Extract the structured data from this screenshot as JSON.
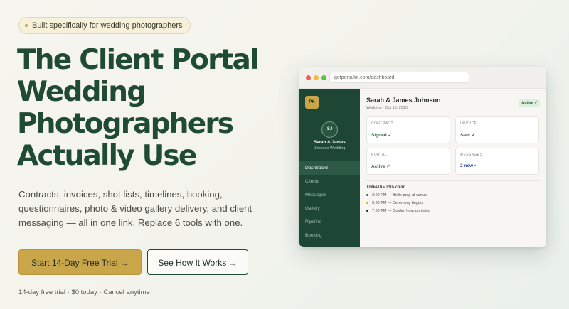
{
  "badge": {
    "text": "Built specifically for wedding photographers"
  },
  "hero": {
    "title_lines": [
      "The Client Portal",
      "Wedding",
      "Photographers",
      "Actually Use"
    ],
    "subtitle": "Contracts, invoices, shot lists, timelines, booking, questionnaires, photo & video gallery delivery, and client messaging — all in one link. Replace 6 tools with one.",
    "primary_cta": "Start 14-Day Free Trial →",
    "secondary_cta": "See How It Works →",
    "fine_print": "14-day free trial · $0 today · Cancel anytime"
  },
  "browser": {
    "url": "getportalkit.com/dashboard",
    "app": {
      "logo": "PK",
      "client": {
        "initials": "SJ",
        "name": "Sarah & James",
        "event": "Johnson Wedding"
      },
      "nav": [
        "Dashboard",
        "Clients",
        "Messages",
        "Gallery",
        "Pipeline",
        "Booking"
      ],
      "main": {
        "title": "Sarah & James Johnson",
        "meta": "Wedding · Oct 18, 2025",
        "status": "Active ✓",
        "cards": [
          {
            "label": "CONTRACT",
            "value": "Signed ✓"
          },
          {
            "label": "INVOICE",
            "value": "Sent ✓"
          },
          {
            "label": "PORTAL",
            "value": "Active ✓"
          },
          {
            "label": "MESSAGES",
            "value": "2 new •"
          }
        ],
        "timeline_title": "TIMELINE PREVIEW",
        "timeline": [
          {
            "text": "3:00 PM — Bride prep at venue",
            "color": "#2a6e45"
          },
          {
            "text": "5:30 PM — Ceremony begins",
            "color": "#c9a64a"
          },
          {
            "text": "7:00 PM — Golden hour portraits",
            "color": "#1f2a22"
          }
        ]
      }
    }
  },
  "colors": {
    "brand_green": "#1f4a34",
    "accent_gold": "#c9a64a",
    "sidebar": "#1e4634"
  }
}
